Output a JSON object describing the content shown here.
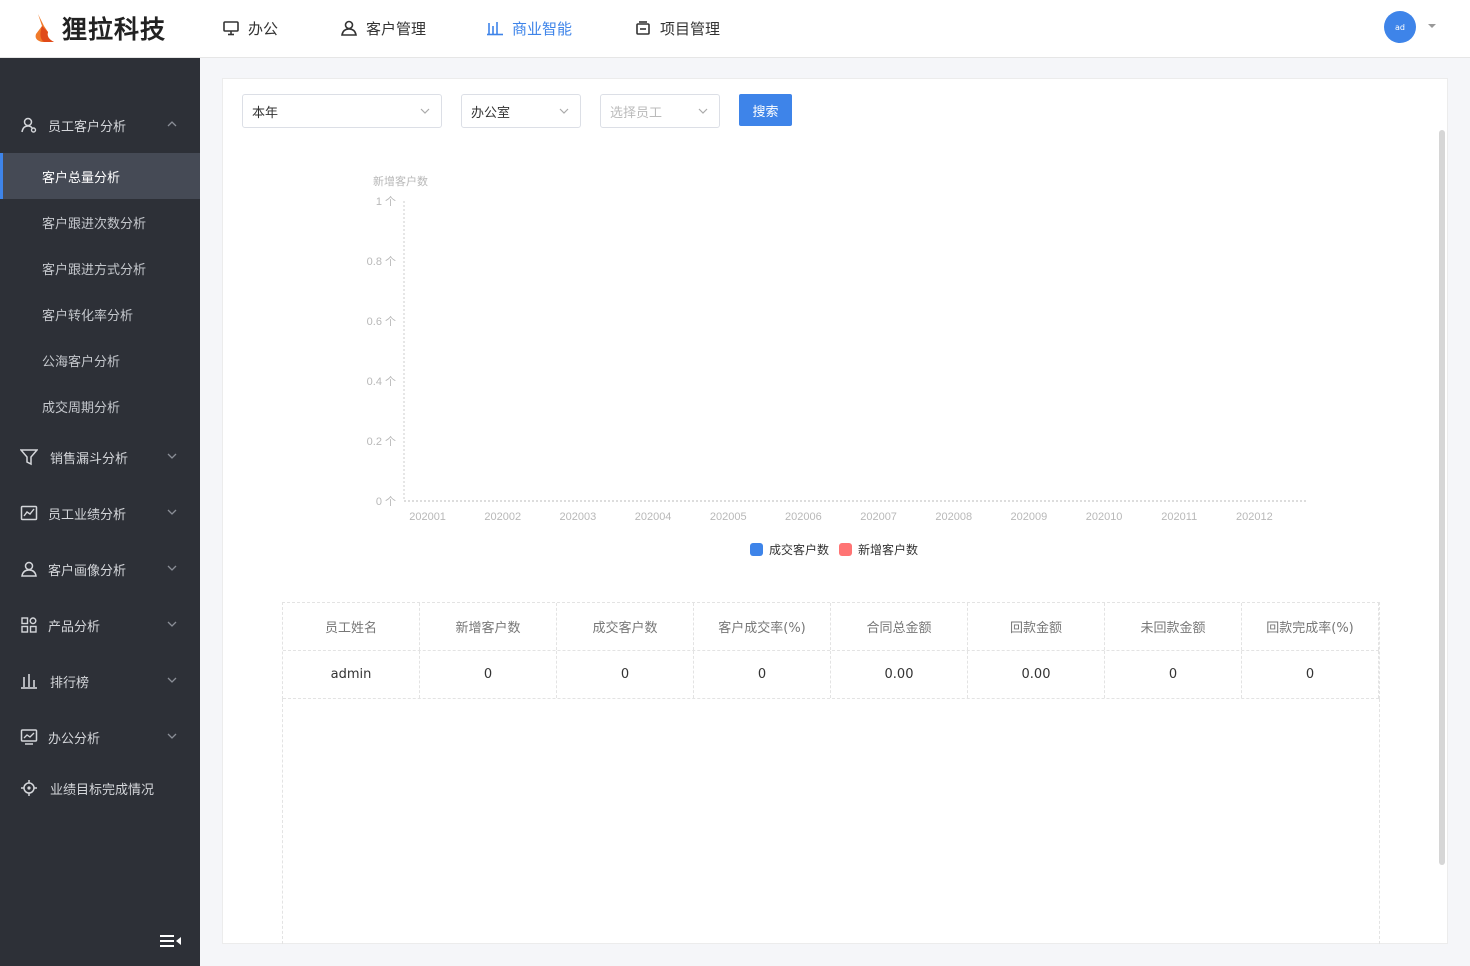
{
  "header": {
    "logo_text": "狸拉科技",
    "nav": [
      {
        "label": "办公",
        "icon": "monitor-icon"
      },
      {
        "label": "客户管理",
        "icon": "customer-icon"
      },
      {
        "label": "商业智能",
        "icon": "bar-chart-icon",
        "active": true
      },
      {
        "label": "项目管理",
        "icon": "project-icon"
      }
    ],
    "avatar_text": "ad",
    "accent_color": "#3e84e9"
  },
  "sidebar": {
    "groups": [
      {
        "label": "员工客户分析",
        "icon": "user-analysis-icon",
        "expanded": true
      },
      {
        "label": "销售漏斗分析",
        "icon": "funnel-icon"
      },
      {
        "label": "员工业绩分析",
        "icon": "performance-icon"
      },
      {
        "label": "客户画像分析",
        "icon": "persona-icon"
      },
      {
        "label": "产品分析",
        "icon": "product-grid-icon"
      },
      {
        "label": "排行榜",
        "icon": "ranking-icon"
      },
      {
        "label": "办公分析",
        "icon": "office-analysis-icon"
      },
      {
        "label": "业绩目标完成情况",
        "icon": "target-icon"
      }
    ],
    "sub_items": [
      {
        "label": "客户总量分析",
        "active": true
      },
      {
        "label": "客户跟进次数分析"
      },
      {
        "label": "客户跟进方式分析"
      },
      {
        "label": "客户转化率分析"
      },
      {
        "label": "公海客户分析"
      },
      {
        "label": "成交周期分析"
      }
    ]
  },
  "filters": {
    "period": "本年",
    "department": "办公室",
    "employee_placeholder": "选择员工",
    "search_label": "搜索"
  },
  "chart_data": {
    "type": "bar",
    "ylabel": "新增客户数",
    "ylim": [
      0,
      1
    ],
    "y_ticks": [
      "1 个",
      "0.8 个",
      "0.6 个",
      "0.4 个",
      "0.2 个",
      "0 个"
    ],
    "categories": [
      "202001",
      "202002",
      "202003",
      "202004",
      "202005",
      "202006",
      "202007",
      "202008",
      "202009",
      "202010",
      "202011",
      "202012"
    ],
    "series": [
      {
        "name": "成交客户数",
        "color": "#3e84e9",
        "values": [
          0,
          0,
          0,
          0,
          0,
          0,
          0,
          0,
          0,
          0,
          0,
          0
        ]
      },
      {
        "name": "新增客户数",
        "color": "#ff7474",
        "values": [
          0,
          0,
          0,
          0,
          0,
          0,
          0,
          0,
          0,
          0,
          0,
          0
        ]
      }
    ],
    "legend_position": "bottom-center"
  },
  "table": {
    "headers": [
      "员工姓名",
      "新增客户数",
      "成交客户数",
      "客户成交率(%)",
      "合同总金额",
      "回款金额",
      "未回款金额",
      "回款完成率(%)"
    ],
    "rows": [
      [
        "admin",
        "0",
        "0",
        "0",
        "0.00",
        "0.00",
        "0",
        "0"
      ]
    ]
  }
}
